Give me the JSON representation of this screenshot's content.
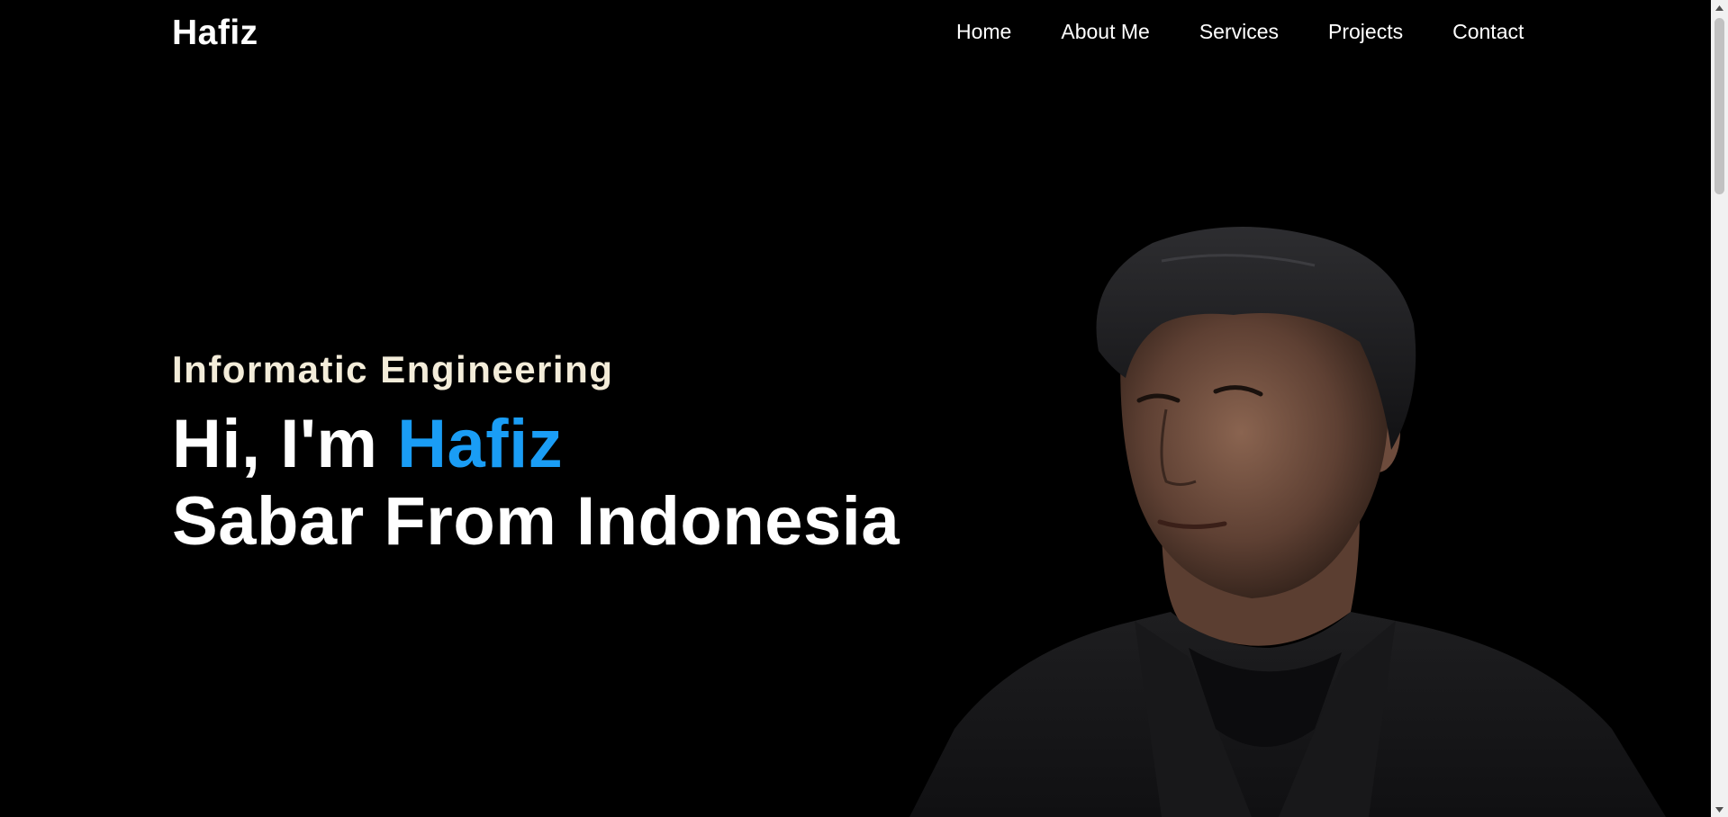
{
  "nav": {
    "logo": "Hafiz",
    "links": [
      {
        "label": "Home"
      },
      {
        "label": "About Me"
      },
      {
        "label": "Services"
      },
      {
        "label": "Projects"
      },
      {
        "label": "Contact"
      }
    ]
  },
  "hero": {
    "subtitle": "Informatic Engineering",
    "greeting": "Hi, I'm ",
    "name_highlight": "Hafiz",
    "second_line": "Sabar From Indonesia",
    "accent_color": "#1a9df5",
    "subtitle_color": "#f3ecd9"
  },
  "portrait": {
    "icon": "profile-photo"
  }
}
